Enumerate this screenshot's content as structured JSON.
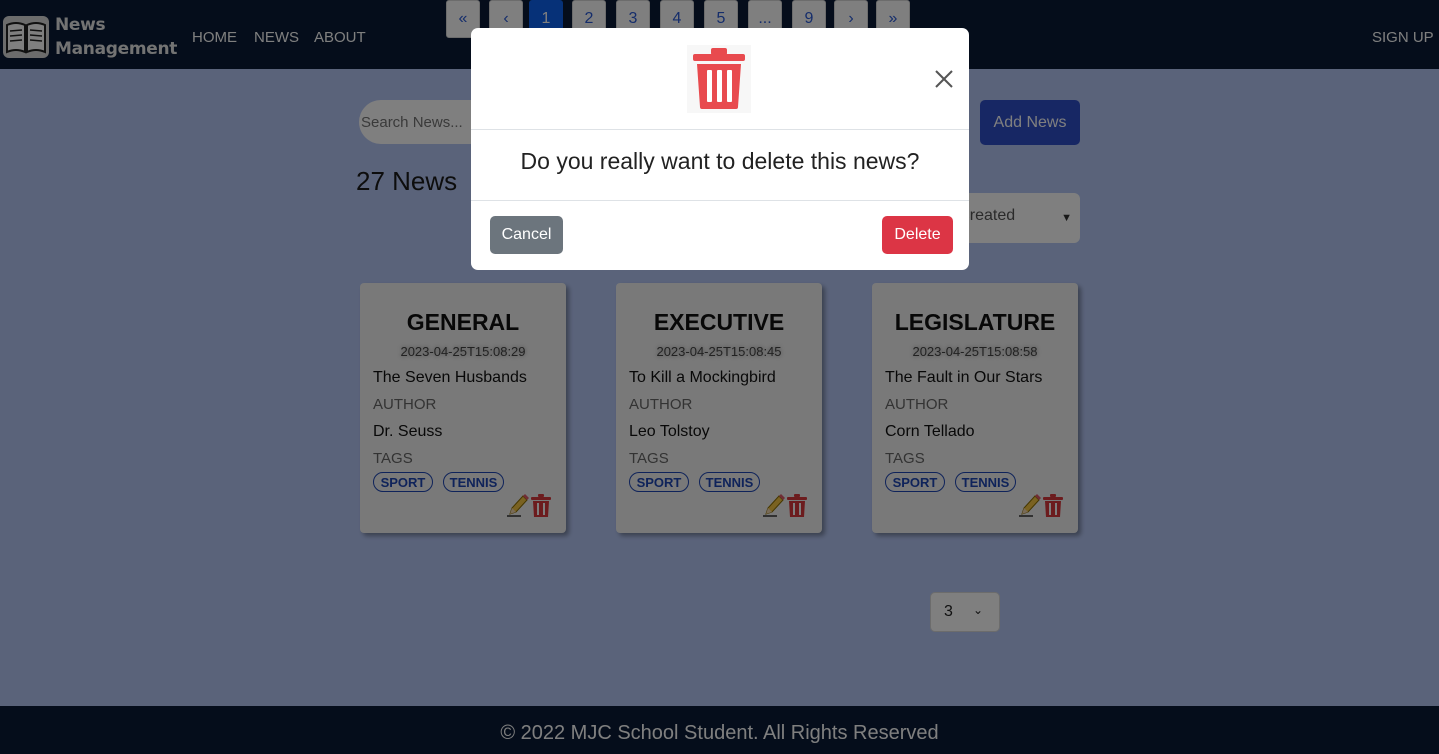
{
  "navbar": {
    "brand_line1": "News",
    "brand_line2": "Management",
    "links": [
      "HOME",
      "NEWS",
      "ABOUT"
    ],
    "signup": "SIGN UP"
  },
  "search": {
    "placeholder": "Search News..."
  },
  "toolbar": {
    "add_label": "Add News"
  },
  "news_count": "27 News",
  "sort": {
    "selected": "Date Created",
    "visible_text": "te Created"
  },
  "cards": [
    {
      "category": "GENERAL",
      "date": "2023-04-25T15:08:29",
      "title": "The Seven Husbands",
      "author_label": "AUTHOR",
      "author": "Dr. Seuss",
      "tags_label": "TAGS",
      "tags": [
        "SPORT",
        "TENNIS"
      ]
    },
    {
      "category": "EXECUTIVE",
      "date": "2023-04-25T15:08:45",
      "title": "To Kill a Mockingbird",
      "author_label": "AUTHOR",
      "author": "Leo Tolstoy",
      "tags_label": "TAGS",
      "tags": [
        "SPORT",
        "TENNIS"
      ]
    },
    {
      "category": "LEGISLATURE",
      "date": "2023-04-25T15:08:58",
      "title": "The Fault in Our Stars",
      "author_label": "AUTHOR",
      "author": "Corn Tellado",
      "tags_label": "TAGS",
      "tags": [
        "SPORT",
        "TENNIS"
      ]
    }
  ],
  "pagination": {
    "first": "«",
    "prev": "‹",
    "pages": [
      "1",
      "2",
      "3",
      "4",
      "5",
      "...",
      "9"
    ],
    "next": "›",
    "last": "»",
    "current": "1",
    "per_page": "3"
  },
  "footer": {
    "text": "© 2022 MJC School Student. All Rights Reserved"
  },
  "modal": {
    "question": "Do you really want to delete this news?",
    "cancel_label": "Cancel",
    "delete_label": "Delete",
    "icon": "trash-icon",
    "close_icon": "close-icon"
  },
  "colors": {
    "navbar": "#0a1b36",
    "background": "#b5c7f5",
    "primary": "#2f4ec9",
    "danger": "#dc3545",
    "secondary": "#6c757d",
    "page_active": "#0d63f0"
  }
}
